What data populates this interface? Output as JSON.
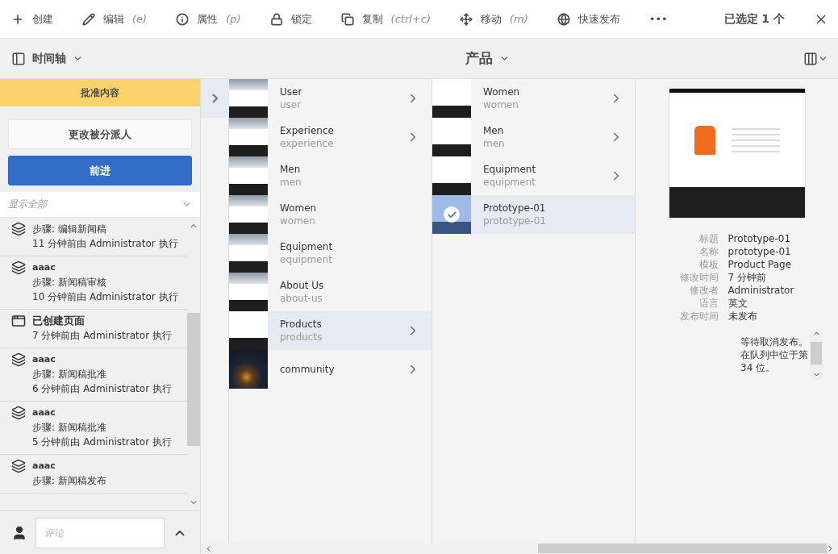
{
  "toolbar": {
    "actions": [
      {
        "label": "创建"
      },
      {
        "label": "编辑",
        "shortcut": "(e)"
      },
      {
        "label": "属性",
        "shortcut": "(p)"
      },
      {
        "label": "锁定"
      },
      {
        "label": "复制",
        "shortcut": "(ctrl+c)"
      },
      {
        "label": "移动",
        "shortcut": "(m)"
      },
      {
        "label": "快速发布"
      }
    ],
    "more": "•••",
    "selection": "已选定 1 个"
  },
  "subbar": {
    "rail": "时间轴",
    "title": "产品"
  },
  "timeline": {
    "task": "批准内容",
    "buttons": [
      "更改被分派人",
      "前进"
    ],
    "filter": {
      "placeholder": "显示全部"
    },
    "events": [
      {
        "kind": "step",
        "step": "步骤: 编辑新闻稿",
        "meta": "11 分钟前由 Administrator 执行"
      },
      {
        "kind": "step",
        "title": "aaac",
        "step": "步骤: 新闻稿审核",
        "meta": "10 分钟前由 Administrator 执行"
      },
      {
        "kind": "page",
        "title": "已创建页面",
        "meta": "7 分钟前由 Administrator 执行"
      },
      {
        "kind": "step",
        "title": "aaac",
        "step": "步骤: 新闻稿批准",
        "meta": "6 分钟前由 Administrator 执行"
      },
      {
        "kind": "step",
        "title": "aaac",
        "step": "步骤: 新闻稿批准",
        "meta": "5 分钟前由 Administrator 执行"
      },
      {
        "kind": "step",
        "title": "aaac",
        "step": "步骤: 新闻稿发布"
      }
    ],
    "comment": {
      "placeholder": "评论"
    }
  },
  "columns": [
    {
      "items": [
        {
          "title": "User",
          "name": "user",
          "kind": "site",
          "children": true,
          "selected": false
        },
        {
          "title": "Experience",
          "name": "experience",
          "kind": "site",
          "children": true,
          "selected": false
        },
        {
          "title": "Men",
          "name": "men",
          "kind": "site",
          "children": false,
          "selected": false
        },
        {
          "title": "Women",
          "name": "women",
          "kind": "site",
          "children": false,
          "selected": false
        },
        {
          "title": "Equipment",
          "name": "equipment",
          "kind": "site",
          "children": false,
          "selected": false
        },
        {
          "title": "About Us",
          "name": "about-us",
          "kind": "site",
          "children": false,
          "selected": false
        },
        {
          "title": "Products",
          "name": "products",
          "kind": "grid",
          "children": true,
          "selected": true
        },
        {
          "title": "community",
          "kind": "night",
          "children": true,
          "selected": false
        }
      ]
    },
    {
      "items": [
        {
          "title": "Women",
          "name": "women",
          "kind": "grid",
          "children": true,
          "selected": false
        },
        {
          "title": "Men",
          "name": "men",
          "kind": "grid",
          "children": true,
          "selected": false
        },
        {
          "title": "Equipment",
          "name": "equipment",
          "kind": "grid",
          "children": true,
          "selected": false
        },
        {
          "title": "Prototype-01",
          "name": "prototype-01",
          "kind": "product",
          "children": false,
          "selected": true
        }
      ]
    }
  ],
  "preview": {
    "fields": [
      {
        "label": "标题",
        "value": "Prototype-01"
      },
      {
        "label": "名称",
        "value": "prototype-01"
      },
      {
        "label": "模板",
        "value": "Product Page"
      },
      {
        "label": "修改时间",
        "value": "7 分钟前"
      },
      {
        "label": "修改者",
        "value": "Administrator"
      },
      {
        "label": "语言",
        "value": "英文"
      },
      {
        "label": "发布时间",
        "value": "未发布"
      }
    ],
    "note": "等待取消发布。在队列中位于第 34 位。"
  }
}
